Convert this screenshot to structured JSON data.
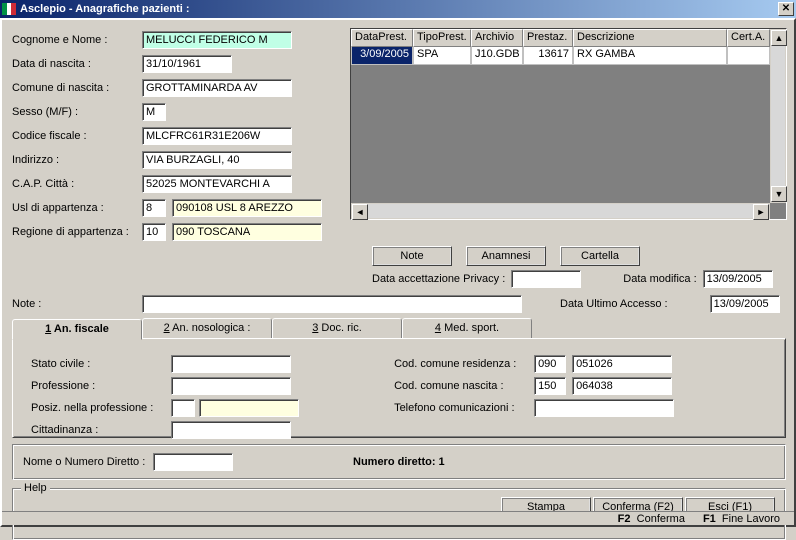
{
  "title": "Asclepio - Anagrafiche pazienti :",
  "form": {
    "cognome_lbl": "Cognome e Nome :",
    "cognome_val": "MELUCCI  FEDERICO M",
    "nascita_lbl": "Data di nascita :",
    "nascita_val": "31/10/1961",
    "comune_lbl": "Comune di nascita :",
    "comune_val": "GROTTAMINARDA AV",
    "sesso_lbl": "Sesso (M/F) :",
    "sesso_val": "M",
    "cf_lbl": "Codice fiscale :",
    "cf_val": "MLCFRC61R31E206W",
    "ind_lbl": "Indirizzo :",
    "ind_val": "VIA BURZAGLI, 40",
    "cap_lbl": "C.A.P. Città :",
    "cap_val": "52025 MONTEVARCHI A",
    "usl_lbl": "Usl di appartenza :",
    "usl_code": "8",
    "usl_val": "090108 USL 8 AREZZO",
    "reg_lbl": "Regione di appartenza :",
    "reg_code": "10",
    "reg_val": "090 TOSCANA",
    "note_lbl": "Note :"
  },
  "grid": {
    "headers": [
      "DataPrest.",
      "TipoPrest.",
      "Archivio",
      "Prestaz.",
      "Descrizione",
      "Cert.A."
    ],
    "row": [
      "3/09/2005",
      "SPA",
      "J10.GDB",
      "13617",
      "RX GAMBA",
      ""
    ]
  },
  "buttons": {
    "note": "Note",
    "anamnesi": "Anamnesi",
    "cartella": "Cartella",
    "stampa": "Stampa",
    "conferma": "Conferma (F2)",
    "esci": "Esci (F1)"
  },
  "privacy": {
    "accett_lbl": "Data accettazione Privacy :",
    "accett_val": "",
    "mod_lbl": "Data modifica :",
    "mod_val": "13/09/2005",
    "last_lbl": "Data Ultimo Accesso :",
    "last_val": "13/09/2005"
  },
  "tabs": {
    "t1": "An. fiscale",
    "t2": "An. nosologica :",
    "t3": "Doc. ric.",
    "t4": "Med. sport."
  },
  "fiscale": {
    "stato_lbl": "Stato civile :",
    "stato_val": "",
    "prof_lbl": "Professione :",
    "prof_val": "",
    "posiz_lbl": "Posiz. nella professione :",
    "posiz_code": "",
    "posiz_val": "",
    "citt_lbl": "Cittadinanza :",
    "citt_val": "",
    "res_lbl": "Cod. comune residenza :",
    "res_code": "090",
    "res_val": "051026",
    "nas_lbl": "Cod. comune nascita :",
    "nas_code": "150",
    "nas_val": "064038",
    "tel_lbl": "Telefono comunicazioni :",
    "tel_val": ""
  },
  "diretto": {
    "lbl": "Nome o Numero Diretto :",
    "val": "",
    "num_lbl": "Numero diretto: 1"
  },
  "help": {
    "legend": "Help"
  },
  "status": {
    "f2": "F2",
    "f2t": "Conferma",
    "f1": "F1",
    "f1t": "Fine Lavoro"
  }
}
